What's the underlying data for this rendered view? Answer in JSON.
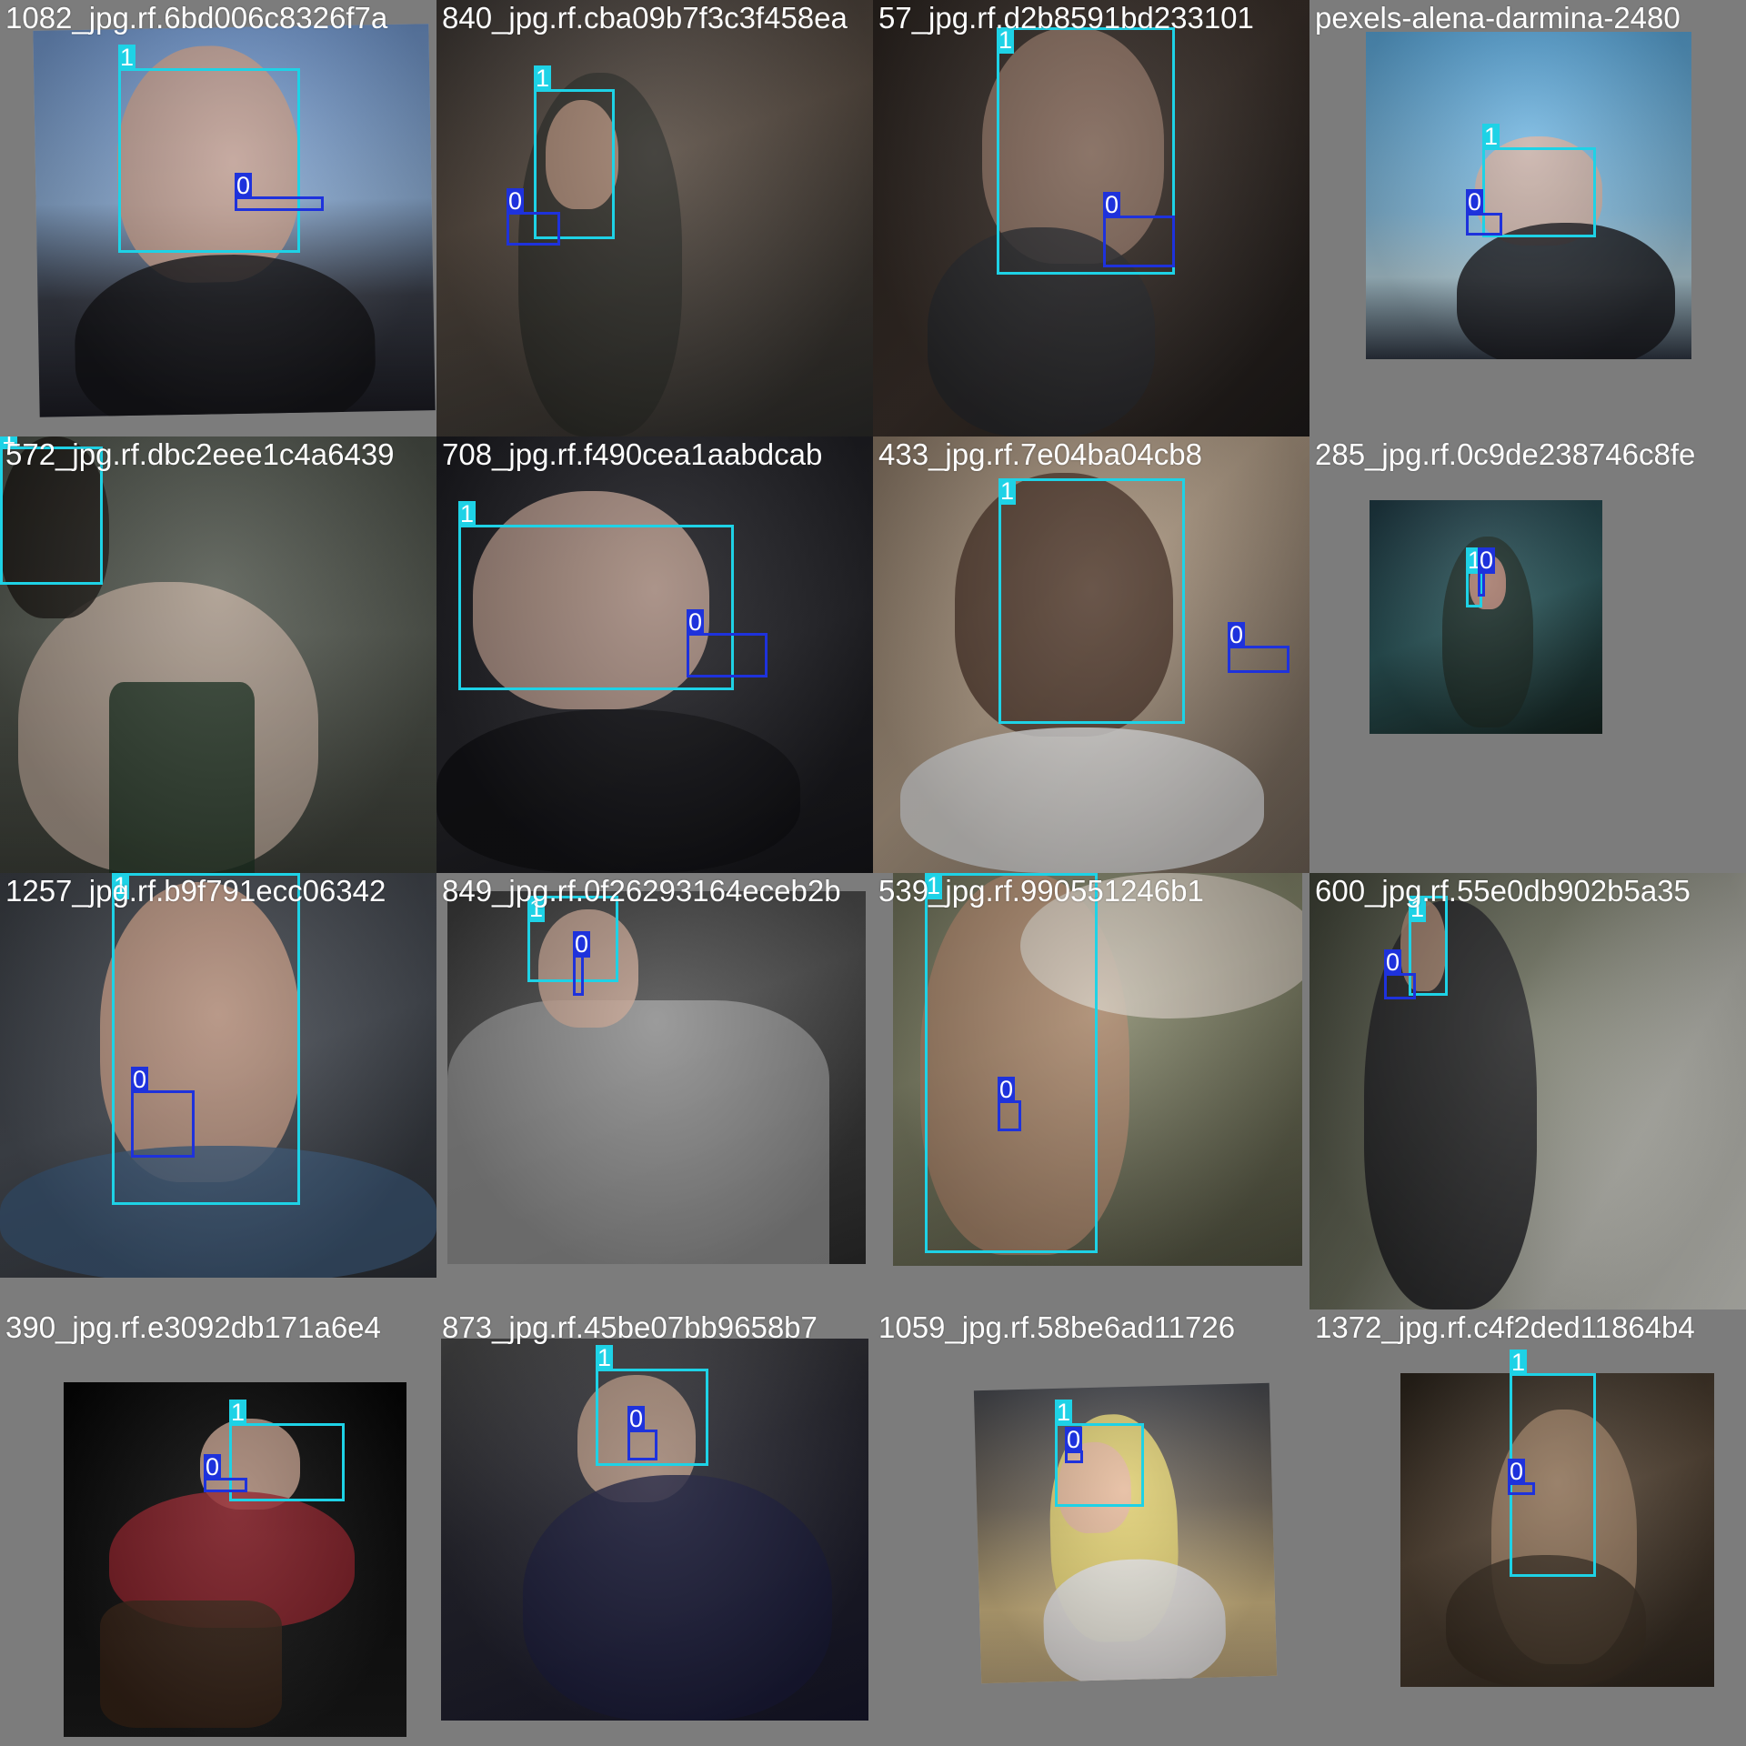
{
  "colors": {
    "class_1": "#1ed2e6",
    "class_0": "#1e32dc",
    "padding_gray": "#7c7c7c",
    "label_text": "#ffffff"
  },
  "class_labels": {
    "person_face": "1",
    "cigarette": "0"
  },
  "tiles": [
    {
      "filename": "1082_jpg.rf.6bd006c8326f7a",
      "labels": [
        "1",
        "0"
      ]
    },
    {
      "filename": "840_jpg.rf.cba09b7f3c3f458ea",
      "labels": [
        "1",
        "0"
      ]
    },
    {
      "filename": "57_jpg.rf.d2b8591bd233101",
      "labels": [
        "1",
        "0"
      ]
    },
    {
      "filename": "pexels-alena-darmina-2480",
      "labels": [
        "1",
        "0"
      ]
    },
    {
      "filename": "572_jpg.rf.dbc2eee1c4a6439",
      "labels": [
        "1"
      ]
    },
    {
      "filename": "708_jpg.rf.f490cea1aabdcab",
      "labels": [
        "1",
        "0"
      ]
    },
    {
      "filename": "433_jpg.rf.7e04ba04cb8",
      "labels": [
        "1",
        "0"
      ]
    },
    {
      "filename": "285_jpg.rf.0c9de238746c8fe",
      "labels": [
        "1",
        "0"
      ]
    },
    {
      "filename": "1257_jpg.rf.b9f791ecc06342",
      "labels": [
        "1",
        "0"
      ]
    },
    {
      "filename": "849_jpg.rf.0f26293164eceb2b",
      "labels": [
        "1",
        "0"
      ]
    },
    {
      "filename": "539_jpg.rf.990551246b1",
      "labels": [
        "1",
        "0"
      ]
    },
    {
      "filename": "600_jpg.rf.55e0db902b5a35",
      "labels": [
        "1",
        "0"
      ]
    },
    {
      "filename": "390_jpg.rf.e3092db171a6e4",
      "labels": [
        "1",
        "0"
      ]
    },
    {
      "filename": "873_jpg.rf.45be07bb9658b7",
      "labels": [
        "1",
        "0"
      ]
    },
    {
      "filename": "1059_jpg.rf.58be6ad11726",
      "labels": [
        "1",
        "0"
      ]
    },
    {
      "filename": "1372_jpg.rf.c4f2ded11864b4",
      "labels": [
        "1",
        "0"
      ]
    }
  ]
}
